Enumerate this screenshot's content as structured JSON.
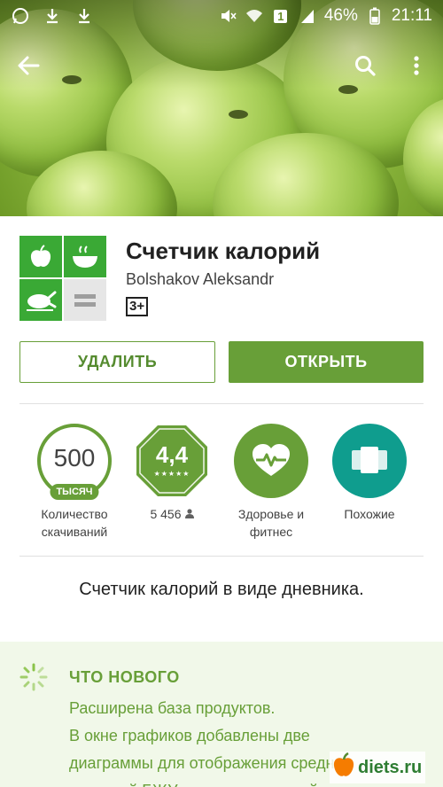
{
  "status_bar": {
    "battery": "46%",
    "time": "21:11",
    "sim_slot": "1"
  },
  "app": {
    "title": "Счетчик калорий",
    "developer": "Bolshakov Aleksandr",
    "content_rating": "3+"
  },
  "buttons": {
    "uninstall": "УДАЛИТЬ",
    "open": "ОТКРЫТЬ"
  },
  "stats": {
    "downloads": {
      "value": "500",
      "unit": "ТЫСЯЧ",
      "label_line1": "Количество",
      "label_line2": "скачиваний"
    },
    "rating": {
      "value": "4,4",
      "stars": "★★★★★",
      "count": "5 456"
    },
    "category": {
      "label_line1": "Здоровье и",
      "label_line2": "фитнес",
      "icon": "heartbeat-icon"
    },
    "similar": {
      "label": "Похожие",
      "icon": "cards-icon"
    }
  },
  "description": "Счетчик калорий в виде дневника.",
  "whats_new": {
    "title": "ЧТО НОВОГО",
    "lines": [
      "Расширена база продуктов.",
      "В окне графиков добавлены две",
      "диаграммы для отображения средних",
      "значений БЖУ за несколько дней"
    ]
  },
  "watermark": "diets.ru",
  "colors": {
    "accent_green": "#689f38",
    "teal": "#0f9d8e",
    "whats_new_bg": "#f1f8e9"
  }
}
